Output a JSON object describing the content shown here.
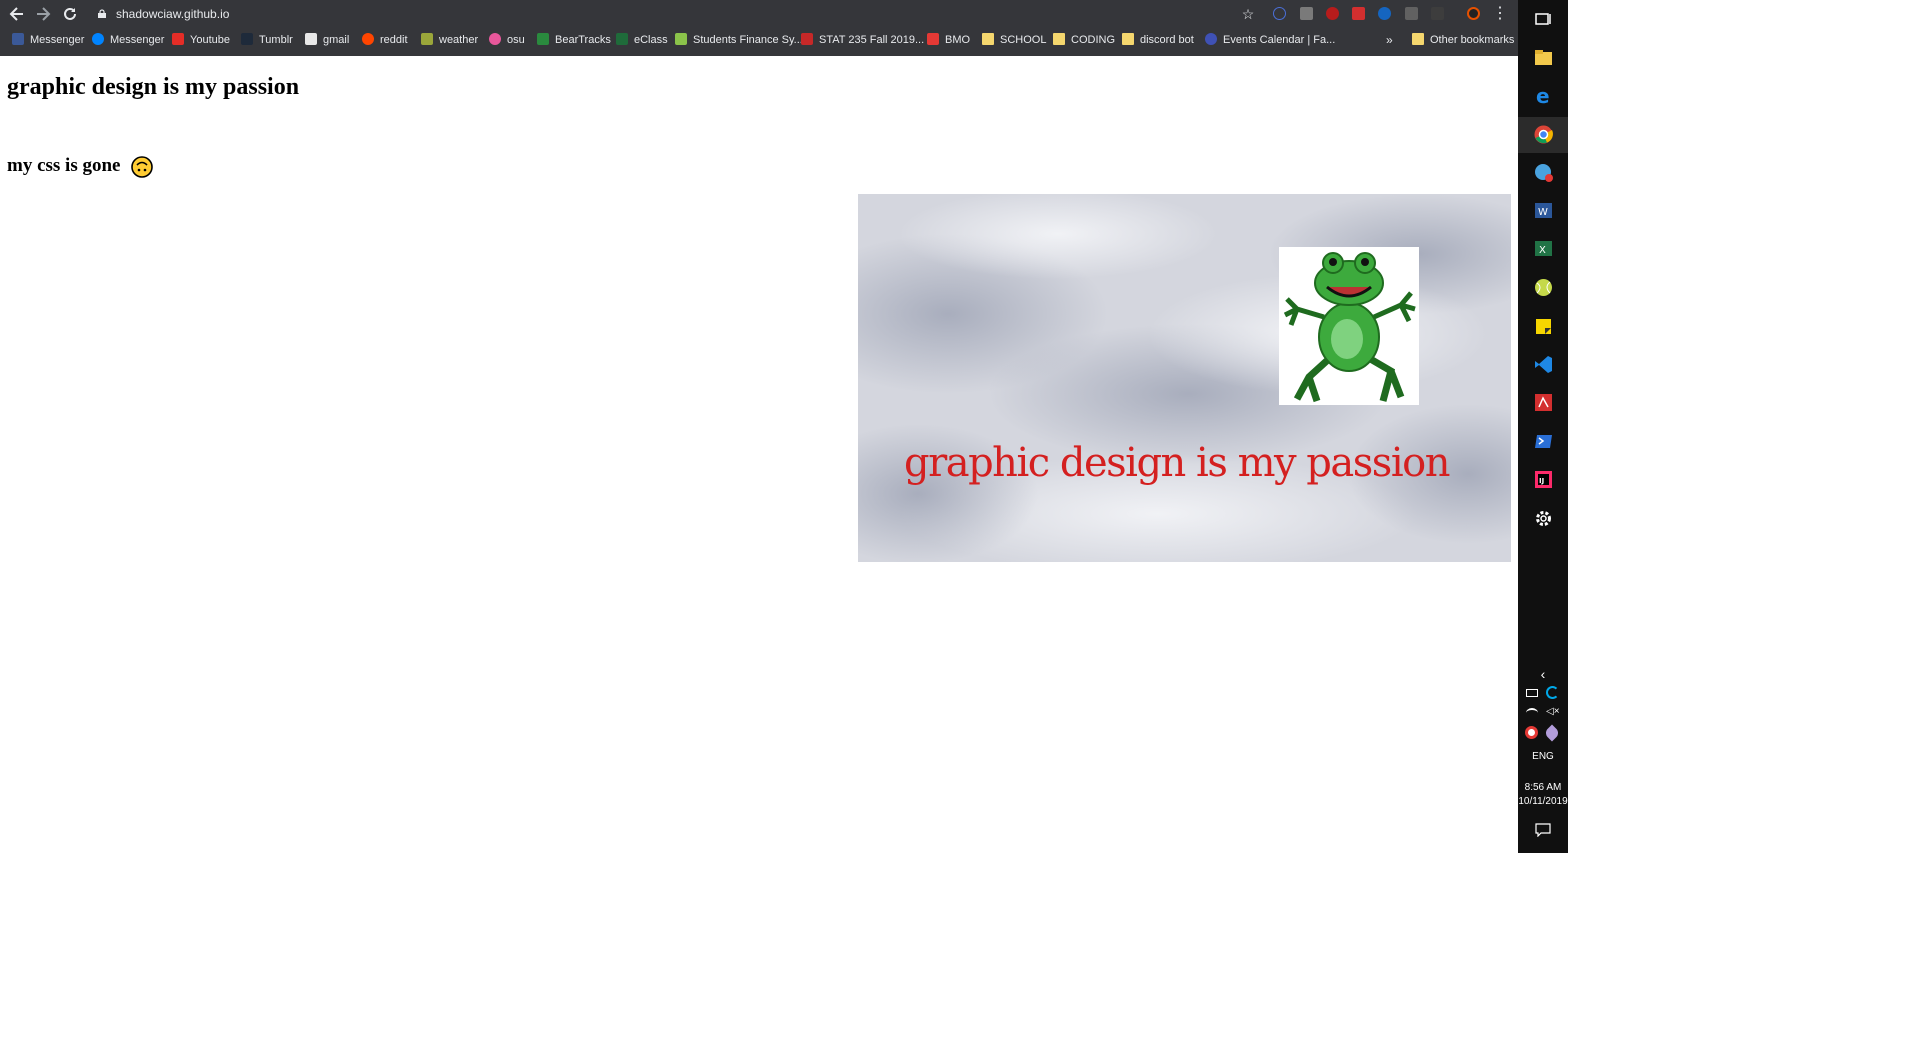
{
  "browser": {
    "url": "shadowciaw.github.io",
    "bookmarks": [
      {
        "label": "Messenger",
        "icon": "facebook-icon",
        "color": "#3b5998"
      },
      {
        "label": "Messenger",
        "icon": "messenger-icon",
        "color": "#0084ff"
      },
      {
        "label": "Youtube",
        "icon": "youtube-icon",
        "color": "#e52d27"
      },
      {
        "label": "Tumblr",
        "icon": "tumblr-icon",
        "color": "#1e2a3a"
      },
      {
        "label": "gmail",
        "icon": "gmail-icon",
        "color": "#e8e8e8"
      },
      {
        "label": "reddit",
        "icon": "reddit-icon",
        "color": "#ff4500"
      },
      {
        "label": "weather",
        "icon": "weather-icon",
        "color": "#9aa63a"
      },
      {
        "label": "osu",
        "icon": "osu-icon",
        "color": "#e8579b"
      },
      {
        "label": "BearTracks",
        "icon": "beartracks-icon",
        "color": "#2a8a3e"
      },
      {
        "label": "eClass",
        "icon": "eclass-icon",
        "color": "#1f6b3a"
      },
      {
        "label": "Students Finance Sy...",
        "icon": "students-finance-icon",
        "color": "#8bc34a"
      },
      {
        "label": "STAT 235 Fall 2019...",
        "icon": "stat-icon",
        "color": "#c62828"
      },
      {
        "label": "BMO",
        "icon": "bmo-icon",
        "color": "#e53935"
      },
      {
        "label": "SCHOOL",
        "icon": "folder-icon",
        "color": "#f5d76e"
      },
      {
        "label": "CODING",
        "icon": "folder-icon",
        "color": "#f5d76e"
      },
      {
        "label": "discord bot",
        "icon": "folder-icon",
        "color": "#f5d76e"
      },
      {
        "label": "Events Calendar | Fa...",
        "icon": "calendar-icon",
        "color": "#3f51b5"
      }
    ],
    "overflow_label": "»",
    "other_bookmarks": "Other bookmarks"
  },
  "page": {
    "heading": "graphic design is my passion",
    "subheading": "my css is gone",
    "emoji": "upside-down-face-icon",
    "meme_caption": "graphic design is my passion",
    "meme_image": "frog-meme-image"
  },
  "taskbar": {
    "language": "ENG",
    "time": "8:56 AM",
    "date": "10/11/2019",
    "apps": [
      "task-view-icon",
      "file-explorer-icon",
      "edge-icon",
      "chrome-icon",
      "mail-icon",
      "word-icon",
      "excel-icon",
      "tennis-icon",
      "sticky-notes-icon",
      "vscode-icon",
      "acrobat-icon",
      "powershell-icon",
      "intellij-icon",
      "settings-icon"
    ]
  },
  "colors": {
    "chrome_bg": "#35363a",
    "taskbar_bg": "#101010",
    "meme_text": "#d42020"
  }
}
